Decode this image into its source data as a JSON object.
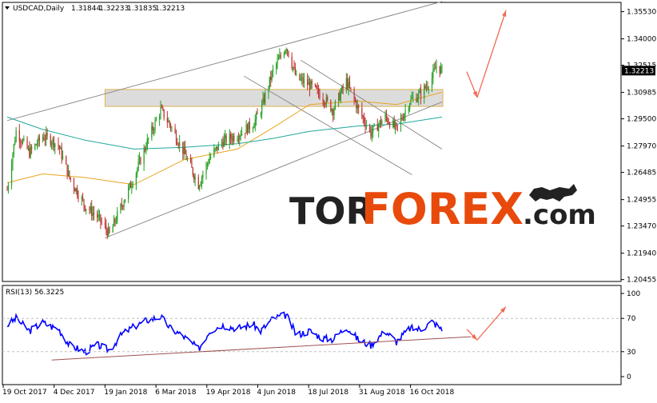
{
  "chart_data": [
    {
      "type": "candlestick",
      "title": "USDCAD,Daily",
      "header_values": [
        "1.31844",
        "1.32233",
        "1.31835",
        "1.32213"
      ],
      "current_price": "1.32213",
      "y_ticks": [
        "1.35530",
        "1.34000",
        "1.32515",
        "1.30985",
        "1.29500",
        "1.27970",
        "1.26485",
        "1.24955",
        "1.23470",
        "1.21940",
        "1.20455"
      ],
      "ylim": [
        1.2035,
        1.3605
      ],
      "x_ticks": [
        "19 Oct 2017",
        "4 Dec 2017",
        "19 Jan 2018",
        "6 Mar 2018",
        "19 Apr 2018",
        "4 Jun 2018",
        "18 Jul 2018",
        "31 Aug 2018",
        "16 Oct 2018"
      ],
      "price_path": [
        {
          "date": "2017-10-19",
          "price": 1.255
        },
        {
          "date": "2017-10-27",
          "price": 1.288
        },
        {
          "date": "2017-11-08",
          "price": 1.276
        },
        {
          "date": "2017-11-20",
          "price": 1.285
        },
        {
          "date": "2017-11-28",
          "price": 1.283
        },
        {
          "date": "2017-12-04",
          "price": 1.28
        },
        {
          "date": "2017-12-14",
          "price": 1.262
        },
        {
          "date": "2017-12-28",
          "price": 1.246
        },
        {
          "date": "2018-01-08",
          "price": 1.24
        },
        {
          "date": "2018-01-19",
          "price": 1.23
        },
        {
          "date": "2018-01-31",
          "price": 1.248
        },
        {
          "date": "2018-02-10",
          "price": 1.262
        },
        {
          "date": "2018-02-22",
          "price": 1.282
        },
        {
          "date": "2018-03-06",
          "price": 1.3
        },
        {
          "date": "2018-03-15",
          "price": 1.291
        },
        {
          "date": "2018-03-27",
          "price": 1.276
        },
        {
          "date": "2018-04-09",
          "price": 1.258
        },
        {
          "date": "2018-04-19",
          "price": 1.273
        },
        {
          "date": "2018-04-30",
          "price": 1.282
        },
        {
          "date": "2018-05-14",
          "price": 1.286
        },
        {
          "date": "2018-05-28",
          "price": 1.292
        },
        {
          "date": "2018-06-04",
          "price": 1.3
        },
        {
          "date": "2018-06-15",
          "price": 1.322
        },
        {
          "date": "2018-06-27",
          "price": 1.336
        },
        {
          "date": "2018-07-06",
          "price": 1.318
        },
        {
          "date": "2018-07-18",
          "price": 1.314
        },
        {
          "date": "2018-07-30",
          "price": 1.307
        },
        {
          "date": "2018-08-08",
          "price": 1.3
        },
        {
          "date": "2018-08-20",
          "price": 1.316
        },
        {
          "date": "2018-08-31",
          "price": 1.3
        },
        {
          "date": "2018-09-11",
          "price": 1.287
        },
        {
          "date": "2018-09-24",
          "price": 1.296
        },
        {
          "date": "2018-10-04",
          "price": 1.289
        },
        {
          "date": "2018-10-16",
          "price": 1.305
        },
        {
          "date": "2018-10-26",
          "price": 1.309
        },
        {
          "date": "2018-11-05",
          "price": 1.318
        },
        {
          "date": "2018-11-09",
          "price": 1.325
        },
        {
          "date": "2018-11-14",
          "price": 1.322
        }
      ],
      "moving_averages": [
        {
          "color": "#e8a41c",
          "points": [
            {
              "date": "2017-10-19",
              "price": 1.259
            },
            {
              "date": "2017-11-20",
              "price": 1.264
            },
            {
              "date": "2017-12-28",
              "price": 1.262
            },
            {
              "date": "2018-02-10",
              "price": 1.258
            },
            {
              "date": "2018-03-27",
              "price": 1.272
            },
            {
              "date": "2018-05-14",
              "price": 1.278
            },
            {
              "date": "2018-06-15",
              "price": 1.29
            },
            {
              "date": "2018-07-18",
              "price": 1.303
            },
            {
              "date": "2018-08-31",
              "price": 1.305
            },
            {
              "date": "2018-10-04",
              "price": 1.303
            },
            {
              "date": "2018-11-14",
              "price": 1.31
            }
          ]
        },
        {
          "color": "#1fa89a",
          "points": [
            {
              "date": "2017-10-19",
              "price": 1.296
            },
            {
              "date": "2017-11-20",
              "price": 1.289
            },
            {
              "date": "2017-12-28",
              "price": 1.283
            },
            {
              "date": "2018-02-10",
              "price": 1.278
            },
            {
              "date": "2018-03-27",
              "price": 1.279
            },
            {
              "date": "2018-05-14",
              "price": 1.281
            },
            {
              "date": "2018-06-15",
              "price": 1.284
            },
            {
              "date": "2018-07-18",
              "price": 1.288
            },
            {
              "date": "2018-08-31",
              "price": 1.291
            },
            {
              "date": "2018-10-04",
              "price": 1.292
            },
            {
              "date": "2018-11-14",
              "price": 1.296
            }
          ]
        }
      ],
      "trend_lines": [
        {
          "name": "channel-upper",
          "color": "#8c8c8c",
          "points": [
            {
              "date": "2017-10-19",
              "price": 1.294
            },
            {
              "date": "2018-11-14",
              "price": 1.361
            }
          ]
        },
        {
          "name": "channel-lower",
          "color": "#8c8c8c",
          "points": [
            {
              "date": "2018-01-15",
              "price": 1.228
            },
            {
              "date": "2018-11-14",
              "price": 1.3045
            }
          ]
        },
        {
          "name": "down-channel-upper",
          "color": "#8c8c8c",
          "points": [
            {
              "date": "2018-07-10",
              "price": 1.328
            },
            {
              "date": "2018-11-14",
              "price": 1.278
            }
          ]
        },
        {
          "name": "down-channel-lower",
          "color": "#8c8c8c",
          "points": [
            {
              "date": "2018-05-20",
              "price": 1.319
            },
            {
              "date": "2018-10-18",
              "price": 1.2635
            }
          ]
        }
      ],
      "zone": {
        "color": "#d0d0d0",
        "price_low": 1.302,
        "price_high": 1.3115,
        "from": "2018-01-15",
        "to": "2018-11-14"
      },
      "forecast_arrows": {
        "color": "#f06a55",
        "points": [
          {
            "date": "2018-11-14",
            "price": 1.3215
          },
          {
            "date": "2018-11-14",
            "price": 1.307
          },
          {
            "date": "2018-11-14",
            "price": 1.356
          }
        ]
      },
      "watermark": {
        "part1": "TOR",
        "part2": "FOREX",
        "part3": ".com"
      }
    },
    {
      "type": "line",
      "title": "RSI(13) 56.3225",
      "y_ticks": [
        "100",
        "70",
        "30",
        "0"
      ],
      "ylim": [
        0,
        100
      ],
      "series": [
        {
          "name": "RSI(13)",
          "color": "#0000ff",
          "values": [
            {
              "date": "2017-10-19",
              "value": 62
            },
            {
              "date": "2017-10-27",
              "value": 70
            },
            {
              "date": "2017-11-08",
              "value": 55
            },
            {
              "date": "2017-11-20",
              "value": 65
            },
            {
              "date": "2017-11-28",
              "value": 60
            },
            {
              "date": "2017-12-04",
              "value": 58
            },
            {
              "date": "2017-12-14",
              "value": 38
            },
            {
              "date": "2017-12-28",
              "value": 30
            },
            {
              "date": "2018-01-08",
              "value": 38
            },
            {
              "date": "2018-01-19",
              "value": 32
            },
            {
              "date": "2018-01-31",
              "value": 52
            },
            {
              "date": "2018-02-10",
              "value": 60
            },
            {
              "date": "2018-02-22",
              "value": 68
            },
            {
              "date": "2018-03-06",
              "value": 72
            },
            {
              "date": "2018-03-15",
              "value": 58
            },
            {
              "date": "2018-03-27",
              "value": 48
            },
            {
              "date": "2018-04-09",
              "value": 33
            },
            {
              "date": "2018-04-19",
              "value": 55
            },
            {
              "date": "2018-04-30",
              "value": 62
            },
            {
              "date": "2018-05-14",
              "value": 58
            },
            {
              "date": "2018-05-28",
              "value": 63
            },
            {
              "date": "2018-06-04",
              "value": 55
            },
            {
              "date": "2018-06-15",
              "value": 70
            },
            {
              "date": "2018-06-27",
              "value": 74
            },
            {
              "date": "2018-07-06",
              "value": 50
            },
            {
              "date": "2018-07-18",
              "value": 55
            },
            {
              "date": "2018-07-30",
              "value": 46
            },
            {
              "date": "2018-08-08",
              "value": 45
            },
            {
              "date": "2018-08-20",
              "value": 60
            },
            {
              "date": "2018-08-31",
              "value": 44
            },
            {
              "date": "2018-09-11",
              "value": 38
            },
            {
              "date": "2018-09-24",
              "value": 55
            },
            {
              "date": "2018-10-04",
              "value": 42
            },
            {
              "date": "2018-10-16",
              "value": 58
            },
            {
              "date": "2018-10-26",
              "value": 57
            },
            {
              "date": "2018-11-05",
              "value": 66
            },
            {
              "date": "2018-11-09",
              "value": 62
            },
            {
              "date": "2018-11-14",
              "value": 56
            }
          ]
        }
      ],
      "trend_line": {
        "color": "#a05050",
        "points": [
          {
            "date": "2017-11-28",
            "value": 20
          },
          {
            "date": "2018-12-10",
            "value": 48
          }
        ]
      },
      "forecast_arrows": {
        "color": "#f06a55",
        "points": [
          {
            "date": "2018-11-14",
            "value": 57
          },
          {
            "date": "2018-11-14",
            "value": 44
          },
          {
            "date": "2018-11-14",
            "value": 84
          }
        ]
      }
    }
  ]
}
